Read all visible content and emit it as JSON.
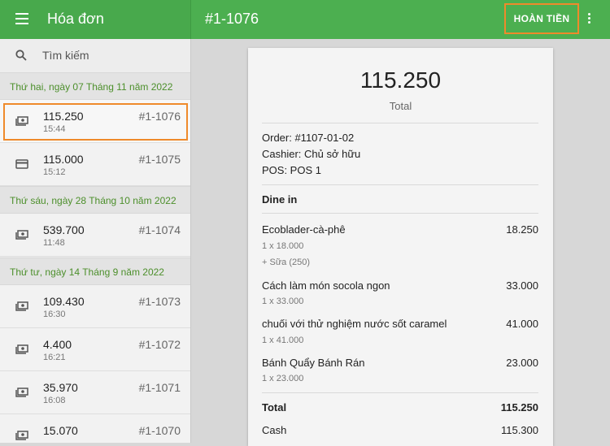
{
  "header": {
    "app_title": "Hóa đơn",
    "receipt_title": "#1-1076",
    "refund_label": "HOÀN TIỀN"
  },
  "search": {
    "placeholder": "Tìm kiếm"
  },
  "groups": [
    {
      "date": "Thứ hai, ngày 07 Tháng 11 năm 2022",
      "rows": [
        {
          "amount": "115.250",
          "time": "15:44",
          "number": "#1-1076",
          "icon": "cash-icon"
        },
        {
          "amount": "115.000",
          "time": "15:12",
          "number": "#1-1075",
          "icon": "card-icon"
        }
      ]
    },
    {
      "date": "Thứ sáu, ngày 28 Tháng 10 năm 2022",
      "rows": [
        {
          "amount": "539.700",
          "time": "11:48",
          "number": "#1-1074",
          "icon": "cash-icon"
        }
      ]
    },
    {
      "date": "Thứ tư, ngày 14 Tháng 9 năm 2022",
      "rows": [
        {
          "amount": "109.430",
          "time": "16:30",
          "number": "#1-1073",
          "icon": "cash-icon"
        },
        {
          "amount": "4.400",
          "time": "16:21",
          "number": "#1-1072",
          "icon": "cash-icon"
        },
        {
          "amount": "35.970",
          "time": "16:08",
          "number": "#1-1071",
          "icon": "cash-icon"
        },
        {
          "amount": "15.070",
          "time": "",
          "number": "#1-1070",
          "icon": "cash-icon"
        }
      ]
    }
  ],
  "receipt": {
    "total_big": "115.250",
    "total_label": "Total",
    "order": "Order: #1107-01-02",
    "cashier": "Cashier: Chủ sở hữu",
    "pos": "POS: POS 1",
    "dining": "Dine in",
    "items": [
      {
        "name": "Ecoblader-cà-phê",
        "price": "18.250",
        "qty": "1 x 18.000",
        "modifier": "+ Sữa (250)"
      },
      {
        "name": "Cách làm món socola ngon",
        "price": "33.000",
        "qty": "1 x 33.000"
      },
      {
        "name": "chuối với thử nghiệm nước sốt caramel",
        "price": "41.000",
        "qty": "1 x 41.000"
      },
      {
        "name": "Bánh Quẩy Bánh Rán",
        "price": "23.000",
        "qty": "1 x 23.000"
      }
    ],
    "total_row_label": "Total",
    "total_row_value": "115.250",
    "cash_label": "Cash",
    "cash_value": "115.300"
  },
  "colors": {
    "header": "#4caf50",
    "accent": "#4c8f2b",
    "highlight": "#ef8a2b"
  }
}
